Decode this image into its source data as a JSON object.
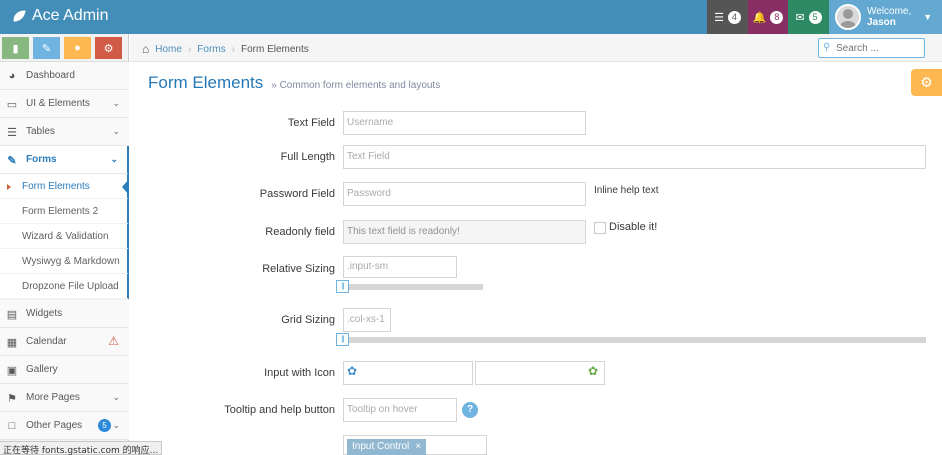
{
  "brand": {
    "name": "Ace Admin"
  },
  "navbar": {
    "tasks_count": "4",
    "notifications_count": "8",
    "messages_count": "5",
    "welcome": "Welcome,",
    "user": "Jason"
  },
  "shortcuts": [
    {
      "icon": "chart-icon",
      "color": "#87b87f"
    },
    {
      "icon": "pencil-icon",
      "color": "#6fb3e0"
    },
    {
      "icon": "users-icon",
      "color": "#ffb752"
    },
    {
      "icon": "cogs-icon",
      "color": "#d15b47"
    }
  ],
  "sidebar": {
    "items": [
      {
        "label": "Dashboard",
        "icon": "tachometer-icon"
      },
      {
        "label": "UI & Elements",
        "icon": "desktop-icon"
      },
      {
        "label": "Tables",
        "icon": "list-icon"
      },
      {
        "label": "Forms",
        "icon": "pencil-square-icon"
      },
      {
        "label": "Widgets",
        "icon": "list-alt-icon"
      },
      {
        "label": "Calendar",
        "icon": "calendar-icon"
      },
      {
        "label": "Gallery",
        "icon": "picture-icon"
      },
      {
        "label": "More Pages",
        "icon": "tag-icon"
      },
      {
        "label": "Other Pages",
        "icon": "file-icon",
        "badge": "5"
      }
    ],
    "subitems": [
      "Form Elements",
      "Form Elements 2",
      "Wizard & Validation",
      "Wysiwyg & Markdown",
      "Dropzone File Upload"
    ]
  },
  "breadcrumb": {
    "home": "Home",
    "section": "Forms",
    "current": "Form Elements"
  },
  "search": {
    "placeholder": "Search ..."
  },
  "page": {
    "title": "Form Elements",
    "subtitle": "» Common form elements and layouts"
  },
  "form": {
    "text_field": {
      "label": "Text Field",
      "placeholder": "Username"
    },
    "full_length": {
      "label": "Full Length",
      "placeholder": "Text Field"
    },
    "password": {
      "label": "Password Field",
      "placeholder": "Password",
      "help": "Inline help text"
    },
    "readonly": {
      "label": "Readonly field",
      "value": "This text field is readonly!",
      "checkbox": "Disable it!"
    },
    "relative": {
      "label": "Relative Sizing",
      "placeholder": ".input-sm"
    },
    "grid": {
      "label": "Grid Sizing",
      "placeholder": ".col-xs-1"
    },
    "icon_input": {
      "label": "Input with Icon"
    },
    "tooltip": {
      "label": "Tooltip and help button",
      "placeholder": "Tooltip on hover",
      "help": "?"
    },
    "tag": {
      "label": "Input Control",
      "close": "×"
    }
  },
  "status_bar": {
    "text": "正在等待 fonts.gstatic.com 的响应..."
  }
}
